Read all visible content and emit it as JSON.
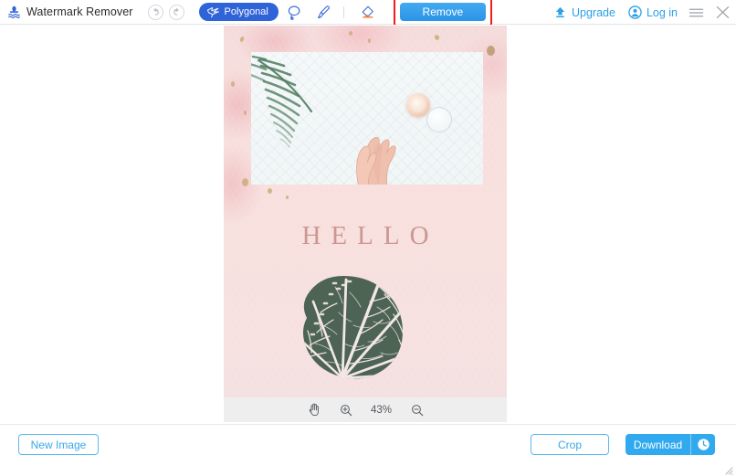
{
  "app": {
    "title": "Watermark Remover",
    "logo_icon": "watermark-logo-icon"
  },
  "header": {
    "history": [
      {
        "name": "undo-button",
        "icon": "undo-arrow-icon"
      },
      {
        "name": "redo-button",
        "icon": "redo-arrow-icon"
      }
    ],
    "tools": [
      {
        "name": "polygonal-tool",
        "label": "Polygonal",
        "icon": "polygonal-lasso-icon",
        "active": true
      },
      {
        "name": "lasso-tool",
        "label": "",
        "icon": "lasso-icon",
        "active": false
      },
      {
        "name": "brush-tool",
        "label": "",
        "icon": "brush-icon",
        "active": false
      },
      {
        "name": "eraser-tool",
        "label": "",
        "icon": "eraser-icon",
        "active": false
      }
    ],
    "remove_label": "Remove",
    "highlight_color": "#f31b1b",
    "accent_color": "#2ba1e8",
    "upgrade_label": "Upgrade",
    "upgrade_icon": "upgrade-arrow-icon",
    "login_label": "Log in",
    "login_icon": "user-avatar-icon",
    "menu_icon": "hamburger-menu-icon",
    "close_icon": "close-icon"
  },
  "canvas": {
    "image_alt": "pink floral poster with hands photo and green leaf print",
    "poster_text": "HELLO",
    "toolbar": {
      "hand_icon": "hand-tool-icon",
      "zoom_in_icon": "zoom-in-icon",
      "zoom_level": "43%",
      "zoom_out_icon": "zoom-out-icon"
    }
  },
  "footer": {
    "new_image_label": "New Image",
    "crop_label": "Crop",
    "download_label": "Download",
    "download_history_icon": "clock-history-icon"
  }
}
